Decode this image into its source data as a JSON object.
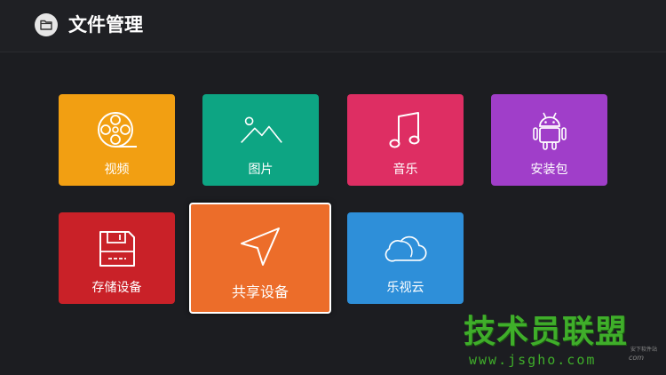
{
  "header": {
    "title": "文件管理",
    "icon": "folder-icon"
  },
  "tiles": [
    {
      "label": "视频",
      "icon": "film-reel-icon",
      "color": "#f29f12"
    },
    {
      "label": "图片",
      "icon": "mountain-image-icon",
      "color": "#0da583"
    },
    {
      "label": "音乐",
      "icon": "music-note-icon",
      "color": "#de2e63"
    },
    {
      "label": "安装包",
      "icon": "android-icon",
      "color": "#a03ec9"
    },
    {
      "label": "存储设备",
      "icon": "floppy-disk-icon",
      "color": "#c92128"
    },
    {
      "label": "共享设备",
      "icon": "navigation-arrow-icon",
      "color": "#ec6d2a",
      "focused": true
    },
    {
      "label": "乐视云",
      "icon": "cloud-icon",
      "color": "#2e8fd9"
    }
  ],
  "watermark": {
    "main": "技术员联盟",
    "url": "www.jsgho.com",
    "small": "安下软件站",
    "small2": "com"
  }
}
